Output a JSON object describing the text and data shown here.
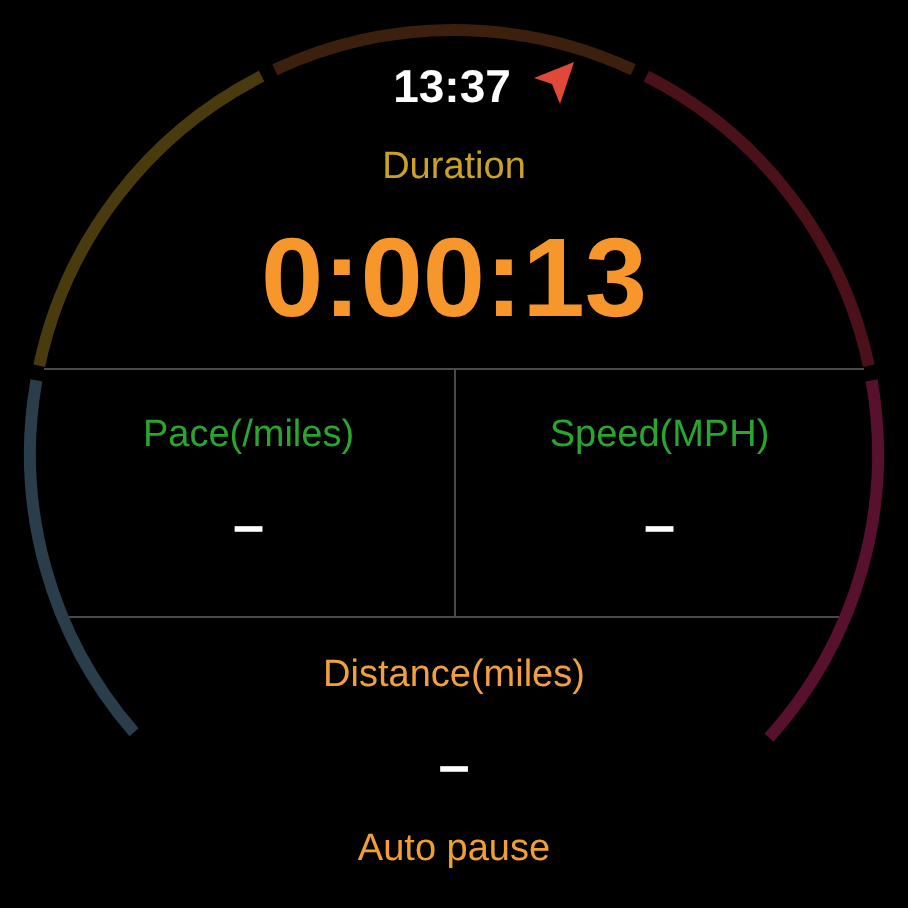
{
  "status": {
    "time": "13:37"
  },
  "duration": {
    "label": "Duration",
    "value": "0:00:13"
  },
  "metrics": [
    {
      "label": "Pace(/miles)",
      "value": "–"
    },
    {
      "label": "Speed(MPH)",
      "value": "–"
    }
  ],
  "distance": {
    "label": "Distance(miles)",
    "value": "–"
  },
  "auto_pause": "Auto pause"
}
